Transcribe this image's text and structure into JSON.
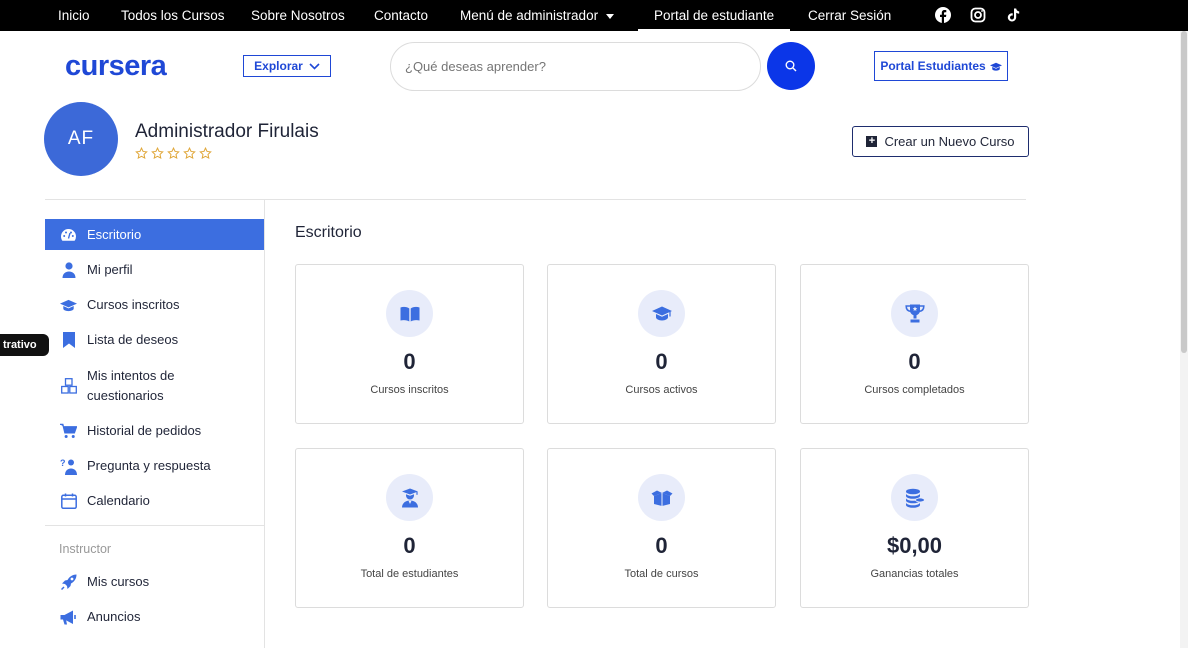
{
  "topnav": {
    "items": [
      {
        "label": "Inicio"
      },
      {
        "label": "Todos los Cursos"
      },
      {
        "label": "Sobre Nosotros"
      },
      {
        "label": "Contacto"
      },
      {
        "label": "Menú de administrador"
      },
      {
        "label": "Portal de estudiante"
      },
      {
        "label": "Cerrar Sesión"
      }
    ],
    "social_icons": [
      "facebook-icon",
      "instagram-icon",
      "tiktok-icon"
    ]
  },
  "header": {
    "logo": "cursera",
    "explore_label": "Explorar",
    "search_placeholder": "¿Qué deseas aprender?",
    "portal_label": "Portal Estudiantes"
  },
  "profile": {
    "initials": "AF",
    "name": "Administrador Firulais",
    "rating_stars": 5,
    "rating_value": 0,
    "create_course_label": "Crear un Nuevo Curso"
  },
  "side_tag": "trativo",
  "sidebar": {
    "items": [
      {
        "label": "Escritorio",
        "icon": "dashboard-icon",
        "active": true
      },
      {
        "label": "Mi perfil",
        "icon": "user-icon"
      },
      {
        "label": "Cursos inscritos",
        "icon": "graduation-cap-icon"
      },
      {
        "label": "Lista de deseos",
        "icon": "bookmark-icon"
      },
      {
        "label": "Mis intentos de cuestionarios",
        "icon": "quiz-icon"
      },
      {
        "label": "Historial de pedidos",
        "icon": "cart-icon"
      },
      {
        "label": "Pregunta y respuesta",
        "icon": "question-person-icon"
      },
      {
        "label": "Calendario",
        "icon": "calendar-icon"
      }
    ],
    "section_title": "Instructor",
    "instructor_items": [
      {
        "label": "Mis cursos",
        "icon": "rocket-icon"
      },
      {
        "label": "Anuncios",
        "icon": "megaphone-icon"
      }
    ]
  },
  "main": {
    "title": "Escritorio",
    "cards": [
      {
        "value": "0",
        "label": "Cursos inscritos",
        "icon": "book-open-icon"
      },
      {
        "value": "0",
        "label": "Cursos activos",
        "icon": "graduation-cap-icon"
      },
      {
        "value": "0",
        "label": "Cursos completados",
        "icon": "trophy-icon"
      },
      {
        "value": "0",
        "label": "Total de estudiantes",
        "icon": "student-icon"
      },
      {
        "value": "0",
        "label": "Total de cursos",
        "icon": "box-open-icon"
      },
      {
        "value": "$0,00",
        "label": "Ganancias totales",
        "icon": "coins-icon"
      }
    ]
  },
  "colors": {
    "accent": "#1f48d6",
    "sidebar_active": "#3c6ee0",
    "search_button": "#0b36e8",
    "avatar_bg": "#3c69d8",
    "star": "#e0a73a"
  }
}
